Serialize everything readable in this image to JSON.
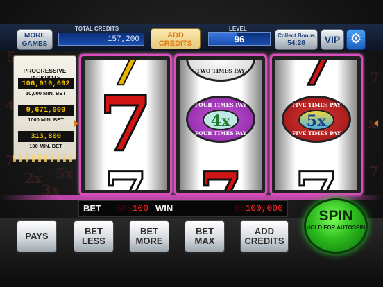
{
  "top": {
    "more_games": "MORE GAMES",
    "total_credits_label": "TOTAL CREDITS",
    "total_credits": "157,200",
    "add_credits": "ADD CREDITS",
    "level_label": "LEVEL",
    "level": "96",
    "level_progress": 0.45,
    "collect_bonus_label": "Collect Bonus",
    "collect_bonus_timer": "54:28",
    "vip": "VIP",
    "settings_icon": "gear-icon"
  },
  "jackpots": {
    "title": "PROGRESSIVE JACKPOTS",
    "items": [
      {
        "value": "106,910,092",
        "min_bet": "10,000 MIN. BET"
      },
      {
        "value": "9,671,009",
        "min_bet": "1000 MIN. BET"
      },
      {
        "value": "313,800",
        "min_bet": "100 MIN. BET"
      }
    ]
  },
  "reels": {
    "reel2_top": "TWO TIMES PAY",
    "reel2_center_top": "FOUR TIMES PAY",
    "reel2_center_mult": "4x",
    "reel2_center_bottom": "FOUR TIMES PAY",
    "reel3_center_top": "FIVE TIMES PAY",
    "reel3_center_mult": "5x",
    "reel3_center_bottom": "FIVE TIMES PAY"
  },
  "bet_bar": {
    "bet_label": "BET",
    "bet_value": "100",
    "win_label": "WIN",
    "win_value": "100,000"
  },
  "controls": {
    "pays": "PAYS",
    "bet_less": "BET LESS",
    "bet_more": "BET MORE",
    "bet_max": "BET MAX",
    "add_credits": "ADD CREDITS",
    "spin": "SPIN",
    "spin_sub": "HOLD FOR AUTOSPIN"
  },
  "colors": {
    "reel_border": "#d94dbf",
    "seven_red": "#d11414",
    "spin_green": "#2ebd1e",
    "led_red": "#ff2a2a",
    "jackpot_gold": "#f5c200"
  }
}
